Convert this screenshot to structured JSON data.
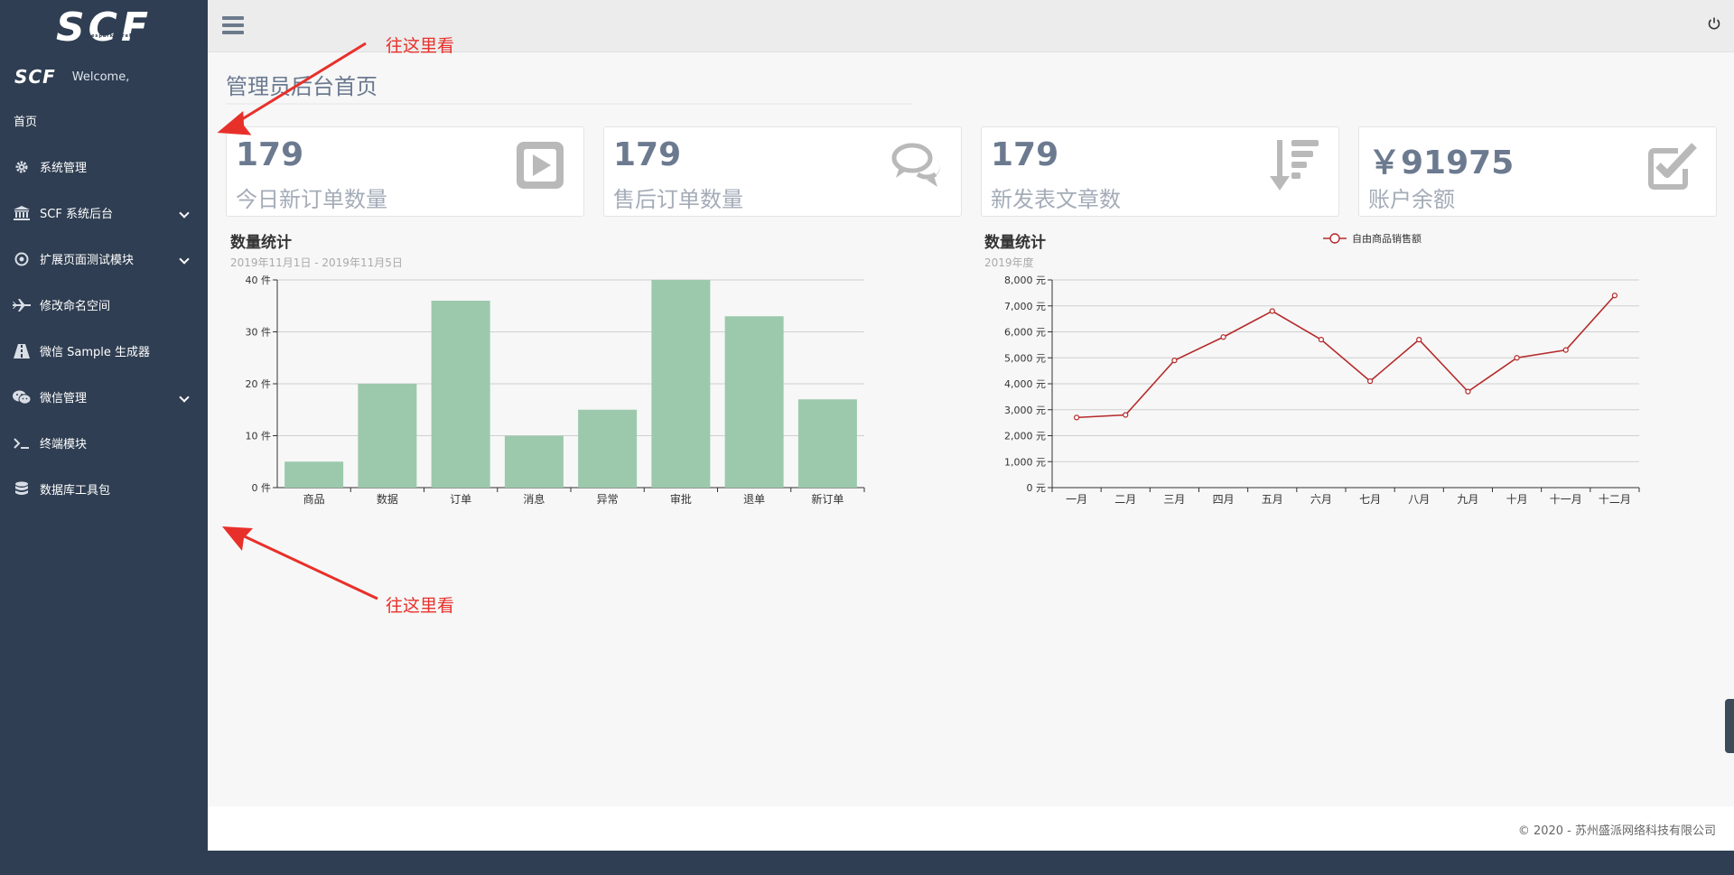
{
  "brand": {
    "logo": "SCF",
    "logo_small": "SeesparkCoreFramework",
    "mini_logo": "SCF",
    "welcome": "Welcome,"
  },
  "sidebar": {
    "items": [
      {
        "label": "首页",
        "icon": "none"
      },
      {
        "label": "系统管理",
        "icon": "gear-icon"
      },
      {
        "label": "SCF 系统后台",
        "icon": "bank-icon",
        "expandable": true
      },
      {
        "label": "扩展页面测试模块",
        "icon": "target-icon",
        "expandable": true
      },
      {
        "label": "修改命名空间",
        "icon": "plane-icon"
      },
      {
        "label": "微信 Sample 生成器",
        "icon": "road-icon"
      },
      {
        "label": "微信管理",
        "icon": "wechat-icon",
        "expandable": true
      },
      {
        "label": "终端模块",
        "icon": "terminal-icon"
      },
      {
        "label": "数据库工具包",
        "icon": "database-icon"
      }
    ]
  },
  "page": {
    "title": "管理员后台首页"
  },
  "stats": [
    {
      "value": "179",
      "label": "今日新订单数量",
      "icon": "play-icon"
    },
    {
      "value": "179",
      "label": "售后订单数量",
      "icon": "comments-icon"
    },
    {
      "value": "179",
      "label": "新发表文章数",
      "icon": "sort-icon"
    },
    {
      "value": "￥91975",
      "label": "账户余额",
      "icon": "check-square-icon"
    }
  ],
  "charts": [
    {
      "title": "数量统计",
      "subtitle": "2019年11月1日 - 2019年11月5日"
    },
    {
      "title": "数量统计",
      "subtitle": "2019年度"
    }
  ],
  "chart_data": [
    {
      "type": "bar",
      "categories": [
        "商品",
        "数据",
        "订单",
        "消息",
        "异常",
        "审批",
        "退单",
        "新订单"
      ],
      "values": [
        5,
        20,
        36,
        10,
        15,
        40,
        33,
        17
      ],
      "ylim": [
        0,
        40
      ],
      "yticks": [
        "0 件",
        "10 件",
        "20 件",
        "30 件",
        "40 件"
      ],
      "color": "#9cc9ac"
    },
    {
      "type": "line",
      "categories": [
        "一月",
        "二月",
        "三月",
        "四月",
        "五月",
        "六月",
        "七月",
        "八月",
        "九月",
        "十月",
        "十一月",
        "十二月"
      ],
      "series": [
        {
          "name": "自由商品销售额",
          "values": [
            2700,
            2800,
            4900,
            5800,
            6800,
            5700,
            4100,
            5700,
            3700,
            5000,
            5300,
            7400
          ]
        }
      ],
      "ylim": [
        0,
        8000
      ],
      "yticks": [
        "0 元",
        "1,000 元",
        "2,000 元",
        "3,000 元",
        "4,000 元",
        "5,000 元",
        "6,000 元",
        "7,000 元",
        "8,000 元"
      ],
      "legend": "top",
      "color": "#b52a2a"
    }
  ],
  "footer": {
    "text": "© 2020 - 苏州盛派网络科技有限公司"
  },
  "annotations": [
    {
      "text": "往这里看"
    },
    {
      "text": "往这里看"
    }
  ]
}
